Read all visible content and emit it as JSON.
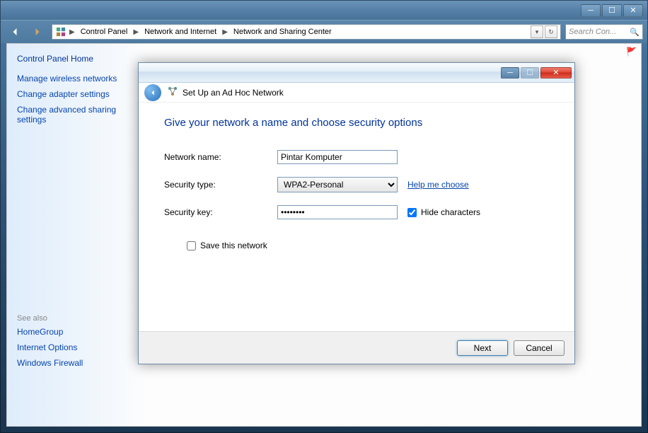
{
  "outer_window": {
    "minimize": "─",
    "maximize": "☐",
    "close": "✕"
  },
  "breadcrumb": {
    "items": [
      "Control Panel",
      "Network and Internet",
      "Network and Sharing Center"
    ],
    "dropdown": "▾",
    "refresh": "↻"
  },
  "search": {
    "placeholder": "Search Con..."
  },
  "sidebar": {
    "home": "Control Panel Home",
    "links": [
      "Manage wireless networks",
      "Change adapter settings",
      "Change advanced sharing settings"
    ],
    "see_also_label": "See also",
    "see_also": [
      "HomeGroup",
      "Internet Options",
      "Windows Firewall"
    ]
  },
  "dialog": {
    "controls": {
      "minimize": "─",
      "maximize": "☐",
      "close": "✕"
    },
    "title": "Set Up an Ad Hoc Network",
    "heading": "Give your network a name and choose security options",
    "labels": {
      "network_name": "Network name:",
      "security_type": "Security type:",
      "security_key": "Security key:",
      "help_link": "Help me choose",
      "hide_chars": "Hide characters",
      "save_network": "Save this network"
    },
    "values": {
      "network_name": "Pintar Komputer",
      "security_type": "WPA2-Personal",
      "security_key": "••••••••",
      "hide_chars_checked": true,
      "save_network_checked": false
    },
    "buttons": {
      "next": "Next",
      "cancel": "Cancel"
    }
  }
}
